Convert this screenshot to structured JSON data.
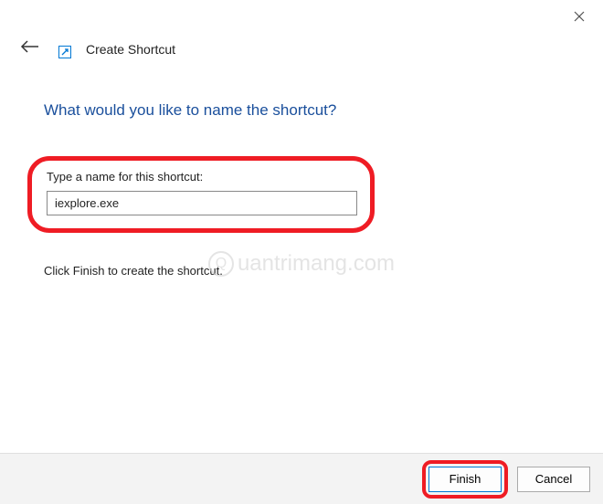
{
  "window": {
    "title": "Create Shortcut"
  },
  "content": {
    "heading": "What would you like to name the shortcut?",
    "input_label": "Type a name for this shortcut:",
    "input_value": "iexplore.exe",
    "instruction": "Click Finish to create the shortcut."
  },
  "buttons": {
    "finish": "Finish",
    "cancel": "Cancel"
  },
  "watermark": {
    "text": "uantrimang.com",
    "symbol": "Q"
  }
}
